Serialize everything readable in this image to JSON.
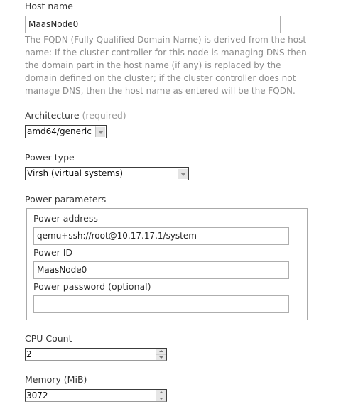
{
  "host_name": {
    "label": "Host name",
    "value": "MaasNode0",
    "help": "The FQDN (Fully Qualified Domain Name) is derived from the host name: If the cluster controller for this node is managing DNS then the domain part in the host name (if any) is replaced by the domain defined on the cluster; if the cluster controller does not manage DNS, then the host name as entered will be the FQDN."
  },
  "architecture": {
    "label": "Architecture",
    "required_note": "(required)",
    "selected": "amd64/generic",
    "dropdown_icon": "chevron-down-icon"
  },
  "power_type": {
    "label": "Power type",
    "selected": "Virsh (virtual systems)",
    "dropdown_icon": "chevron-down-icon"
  },
  "power_parameters": {
    "label": "Power parameters",
    "address": {
      "label": "Power address",
      "value": "qemu+ssh://root@10.17.17.1/system"
    },
    "id": {
      "label": "Power ID",
      "value": "MaasNode0"
    },
    "password": {
      "label": "Power password (optional)",
      "value": ""
    }
  },
  "cpu_count": {
    "label": "CPU Count",
    "value": "2"
  },
  "memory": {
    "label": "Memory (MiB)",
    "value": "3072"
  }
}
